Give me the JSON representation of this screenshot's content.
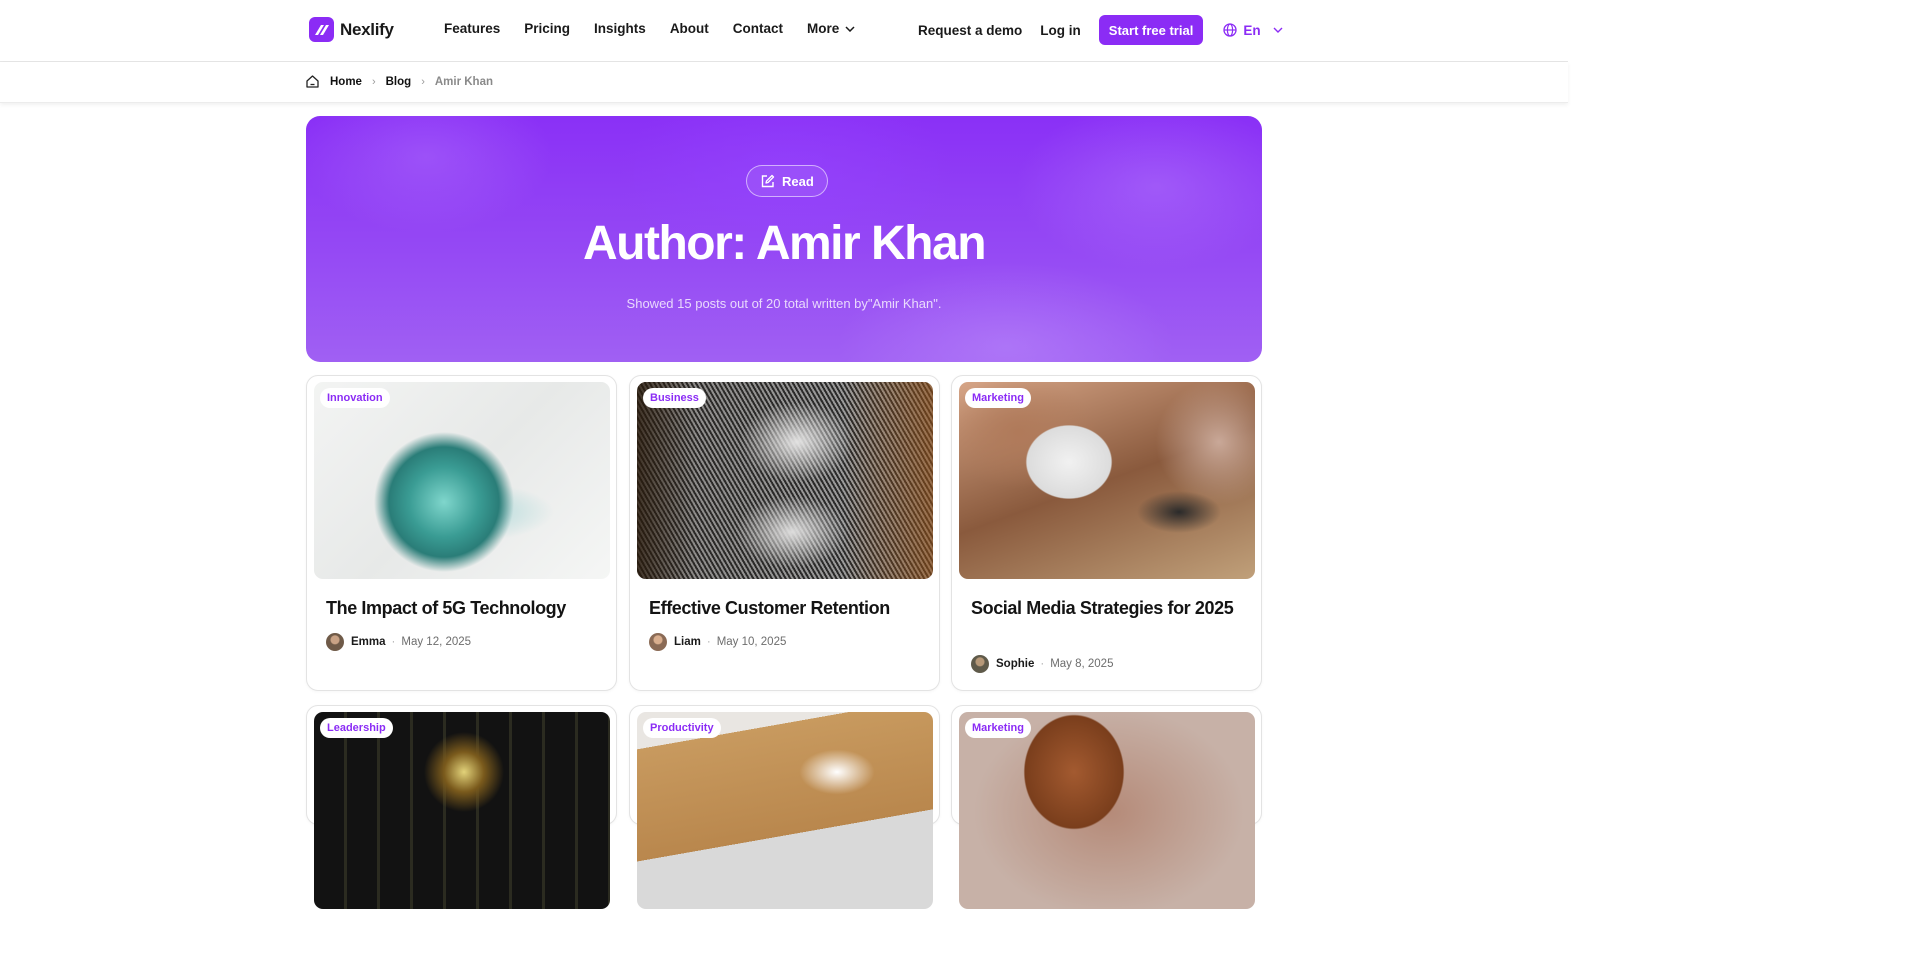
{
  "brand": {
    "name": "Nexlify"
  },
  "nav": {
    "items": [
      "Features",
      "Pricing",
      "Insights",
      "About",
      "Contact"
    ],
    "more_label": "More"
  },
  "header_actions": {
    "demo": "Request a demo",
    "login": "Log in",
    "trial": "Start free trial",
    "lang": "En"
  },
  "breadcrumb": {
    "home": "Home",
    "blog": "Blog",
    "current": "Amir Khan"
  },
  "hero": {
    "pill": "Read",
    "title": "Author: Amir Khan",
    "subtitle": "Showed 15 posts out of 20 total written by\"Amir Khan\"."
  },
  "colors": {
    "accent": "#8b2cf5",
    "hero_start": "#8a30f6",
    "hero_end": "#a060f3"
  },
  "cards": [
    {
      "tag": "Innovation",
      "title": "The Impact of 5G Technology",
      "author": "Emma",
      "date": "May 12, 2025",
      "image": "glass-sphere-sculpture"
    },
    {
      "tag": "Business",
      "title": "Effective Customer Retention",
      "author": "Liam",
      "date": "May 10, 2025",
      "image": "monitors-pattern"
    },
    {
      "tag": "Marketing",
      "title": "Social Media Strategies for 2025",
      "author": "Sophie",
      "date": "May 8, 2025",
      "image": "card-payment-terminal"
    },
    {
      "tag": "Leadership",
      "image": "rgb-keyboard"
    },
    {
      "tag": "Productivity",
      "image": "vr-headset-box"
    },
    {
      "tag": "Marketing",
      "image": "phone-leather-case"
    }
  ]
}
